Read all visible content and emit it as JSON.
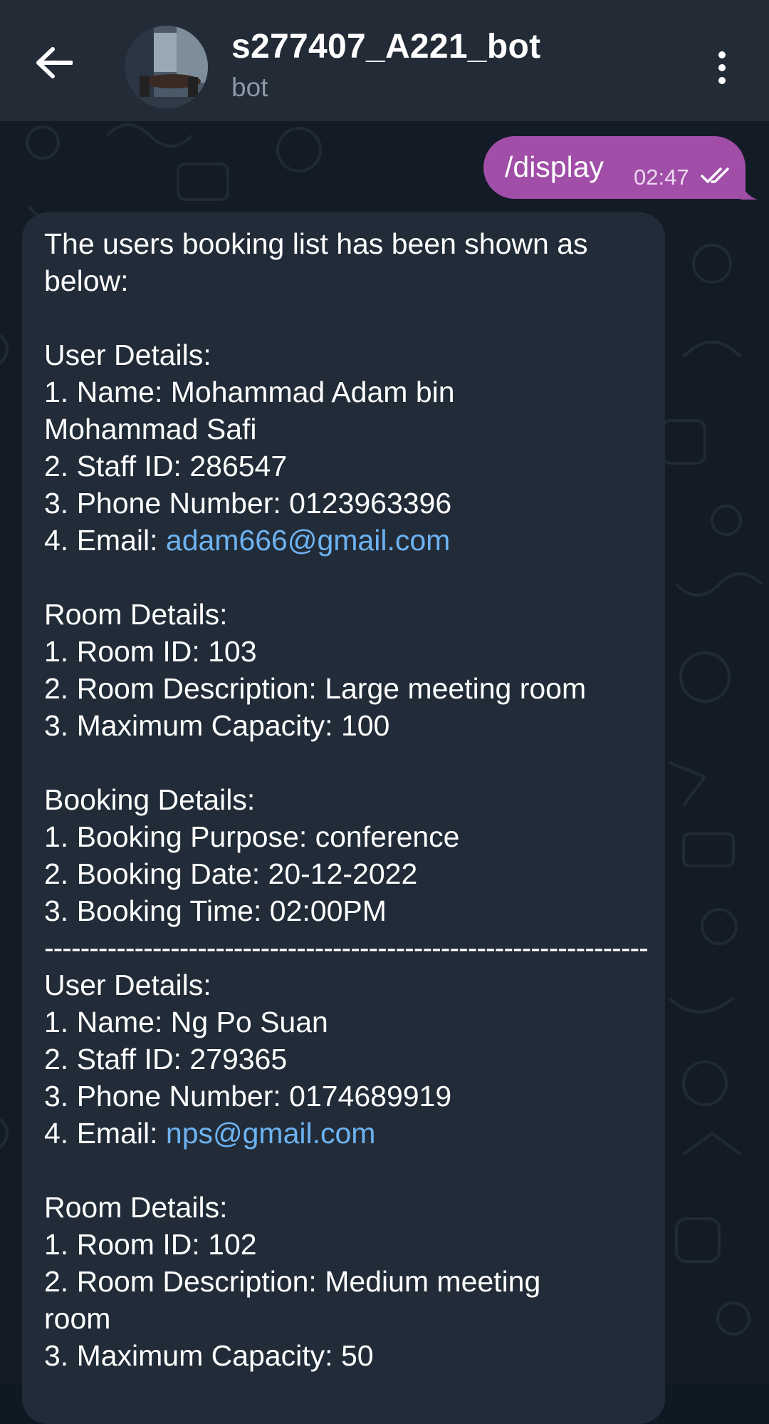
{
  "header": {
    "title": "s277407_A221_bot",
    "subtitle": "bot"
  },
  "outgoing": {
    "text": "/display",
    "time": "02:47"
  },
  "message": {
    "intro1": "The users booking list has been shown as",
    "intro2": "below:",
    "b1": {
      "user_heading": "User Details:",
      "name1": "1. Name: Mohammad Adam bin",
      "name2": "Mohammad Safi",
      "staff": "2. Staff ID: 286547",
      "phone": "3. Phone Number: 0123963396",
      "email_label": "4. Email: ",
      "email": "adam666@gmail.com",
      "room_heading": "Room Details:",
      "room_id": "1. Room ID: 103",
      "room_desc": "2. Room Description: Large meeting room",
      "capacity": "3. Maximum Capacity: 100",
      "booking_heading": "Booking Details:",
      "purpose": "1. Booking Purpose: conference",
      "date": "2. Booking Date: 20-12-2022",
      "time": "3. Booking Time: 02:00PM"
    },
    "separator": "-------------------------------------------------------------------",
    "b2": {
      "user_heading": "User Details:",
      "name": "1. Name: Ng Po Suan",
      "staff": "2. Staff ID: 279365",
      "phone": "3. Phone Number: 0174689919",
      "email_label": "4. Email: ",
      "email": "nps@gmail.com",
      "room_heading": "Room Details:",
      "room_id": "1. Room ID: 102",
      "room_desc1": "2. Room Description: Medium meeting",
      "room_desc2": "room",
      "capacity": "3. Maximum Capacity: 50"
    }
  }
}
